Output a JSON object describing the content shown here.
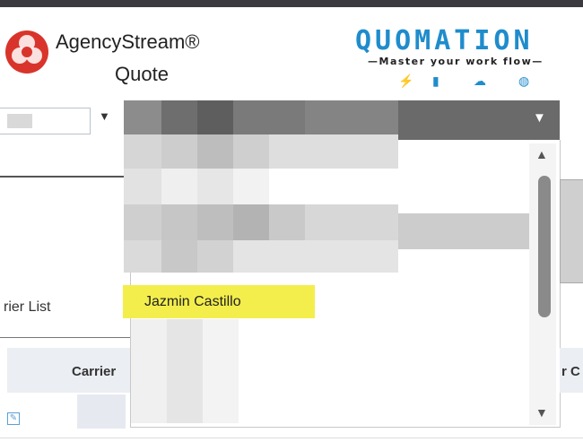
{
  "header": {
    "app_title": "AgencyStream®",
    "app_subtitle": "Quote",
    "quomation_title": "QUOMATION",
    "quomation_tagline": "—Master your work flow—",
    "quomation_icons": [
      "bolt-icon",
      "folder-icon",
      "cloud-icon",
      "globe-icon"
    ]
  },
  "dropdown": {
    "highlighted_option": "Jazmin Castillo"
  },
  "section": {
    "title": "rier List"
  },
  "table": {
    "headers": [
      "Carrier",
      "r C"
    ]
  },
  "colors": {
    "brand_blue": "#1f8ccc",
    "highlight_yellow": "#f3ee4b",
    "select_bar": "#6a6a6a",
    "top_bar": "#3b3a3e"
  }
}
